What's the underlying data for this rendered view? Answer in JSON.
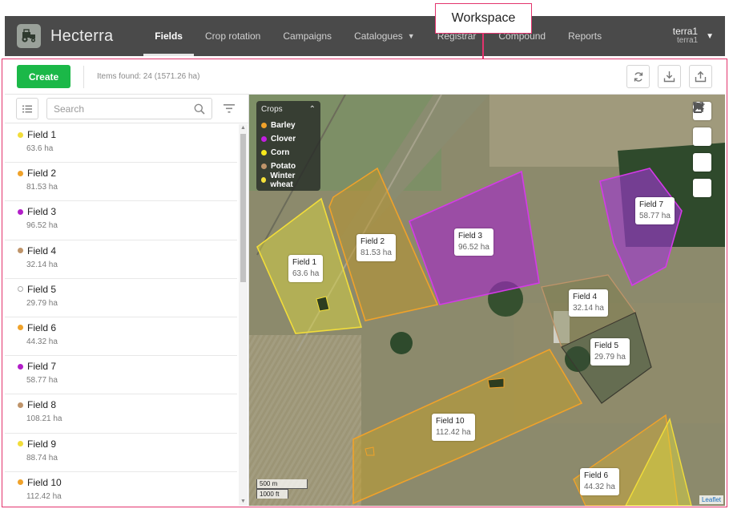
{
  "callout": {
    "label": "Workspace"
  },
  "app": {
    "name": "Hecterra"
  },
  "nav": [
    {
      "label": "Fields",
      "active": true
    },
    {
      "label": "Crop rotation"
    },
    {
      "label": "Campaigns"
    },
    {
      "label": "Catalogues",
      "dropdown": true
    },
    {
      "label": "Registrar"
    },
    {
      "label": "Compound"
    },
    {
      "label": "Reports"
    }
  ],
  "user": {
    "name": "terra1",
    "account": "terra1"
  },
  "toolbar": {
    "create_label": "Create",
    "items_found": "Items found: 24 (1571.26 ha)",
    "icons": [
      "refresh-icon",
      "download-icon",
      "upload-icon"
    ]
  },
  "search": {
    "placeholder": "Search"
  },
  "fields": [
    {
      "name": "Field 1",
      "area": "63.6 ha",
      "color": "#f2dd3a"
    },
    {
      "name": "Field 2",
      "area": "81.53 ha",
      "color": "#f0a22a"
    },
    {
      "name": "Field 3",
      "area": "96.52 ha",
      "color": "#b21ec8"
    },
    {
      "name": "Field 4",
      "area": "32.14 ha",
      "color": "#bf946a"
    },
    {
      "name": "Field 5",
      "area": "29.79 ha",
      "color": "#ffffff"
    },
    {
      "name": "Field 6",
      "area": "44.32 ha",
      "color": "#f0a22a"
    },
    {
      "name": "Field 7",
      "area": "58.77 ha",
      "color": "#b21ec8"
    },
    {
      "name": "Field 8",
      "area": "108.21 ha",
      "color": "#bf946a"
    },
    {
      "name": "Field 9",
      "area": "88.74 ha",
      "color": "#f2dd3a"
    },
    {
      "name": "Field 10",
      "area": "112.42 ha",
      "color": "#f0a22a"
    }
  ],
  "legend": {
    "title": "Crops",
    "items": [
      {
        "label": "Barley",
        "color": "#f0a22a"
      },
      {
        "label": "Clover",
        "color": "#c21fe0"
      },
      {
        "label": "Corn",
        "color": "#f7e81c"
      },
      {
        "label": "Potato",
        "color": "#bf946a"
      },
      {
        "label": "Winter wheat",
        "color": "#f5e13a"
      }
    ]
  },
  "map_labels": [
    {
      "name": "Field 1",
      "area": "63.6 ha"
    },
    {
      "name": "Field 2",
      "area": "81.53 ha"
    },
    {
      "name": "Field 3",
      "area": "96.52 ha"
    },
    {
      "name": "Field 4",
      "area": "32.14 ha"
    },
    {
      "name": "Field 5",
      "area": "29.79 ha"
    },
    {
      "name": "Field 6",
      "area": "44.32 ha"
    },
    {
      "name": "Field 7",
      "area": "58.77 ha"
    },
    {
      "name": "Field 10",
      "area": "112.42 ha"
    }
  ],
  "map_controls": [
    "layers-icon",
    "fullscreen-icon",
    "tag-icon",
    "add-image-icon"
  ],
  "scale": {
    "metric": "500 m",
    "imperial": "1000 ft"
  },
  "attribution": "Leaflet"
}
